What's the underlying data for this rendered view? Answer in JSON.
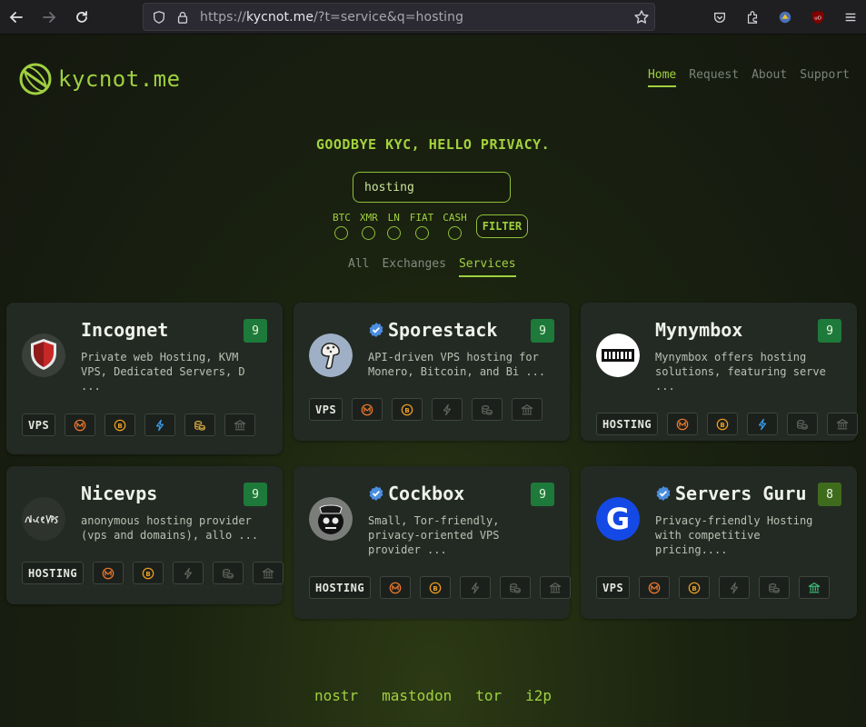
{
  "browser": {
    "url_prefix": "https://",
    "url_domain": "kycnot.me",
    "url_path": "/?t=service&q=hosting"
  },
  "site": {
    "logo_text": "kycnot.me",
    "nav": [
      {
        "label": "Home",
        "active": true
      },
      {
        "label": "Request",
        "active": false
      },
      {
        "label": "About",
        "active": false
      },
      {
        "label": "Support",
        "active": false
      }
    ],
    "tagline": "GOODBYE KYC, HELLO PRIVACY.",
    "search_value": "hosting",
    "filters": [
      "BTC",
      "XMR",
      "LN",
      "FIAT",
      "CASH"
    ],
    "filter_button": "FILTER",
    "type_tabs": [
      {
        "label": "All",
        "active": false
      },
      {
        "label": "Exchanges",
        "active": false
      },
      {
        "label": "Services",
        "active": true
      }
    ]
  },
  "cards": [
    {
      "name": "Incognet",
      "verified": false,
      "score": "9",
      "desc": "Private web Hosting, KVM VPS, Dedicated Servers, D ...",
      "tag": "VPS",
      "payments": {
        "xmr": true,
        "btc": true,
        "ln": true,
        "cash": true,
        "fiat": false
      }
    },
    {
      "name": "Sporestack",
      "verified": true,
      "score": "9",
      "desc": "API-driven VPS hosting for Monero, Bitcoin, and Bi ...",
      "tag": "VPS",
      "payments": {
        "xmr": true,
        "btc": true,
        "ln": false,
        "cash": false,
        "fiat": false
      }
    },
    {
      "name": "Mynymbox",
      "verified": false,
      "score": "9",
      "desc": "Mynymbox offers hosting solutions, featuring serve ...",
      "tag": "HOSTING",
      "payments": {
        "xmr": true,
        "btc": true,
        "ln": true,
        "cash": false,
        "fiat": false
      }
    },
    {
      "name": "Nicevps",
      "verified": false,
      "score": "9",
      "desc": "anonymous hosting provider (vps and domains), allo ...",
      "tag": "HOSTING",
      "payments": {
        "xmr": true,
        "btc": true,
        "ln": false,
        "cash": false,
        "fiat": false
      }
    },
    {
      "name": "Cockbox",
      "verified": true,
      "score": "9",
      "desc": "Small, Tor-friendly, privacy-oriented VPS provider ...",
      "tag": "HOSTING",
      "payments": {
        "xmr": true,
        "btc": true,
        "ln": false,
        "cash": false,
        "fiat": false
      }
    },
    {
      "name": "Servers Guru",
      "verified": true,
      "score": "8",
      "desc": "Privacy-friendly Hosting with competitive pricing....",
      "tag": "VPS",
      "payments": {
        "xmr": true,
        "btc": true,
        "ln": false,
        "cash": false,
        "fiat": true
      }
    }
  ],
  "footer_links": [
    "nostr",
    "mastodon",
    "tor",
    "i2p"
  ],
  "colors": {
    "accent": "#9fd040",
    "score_green": "#1e7a3a",
    "xmr": "#f07a2e",
    "btc": "#f0a020",
    "ln": "#3aa0f0",
    "cash": "#e0b040",
    "fiat": "#3ec07a",
    "disabled": "#5f655d"
  }
}
